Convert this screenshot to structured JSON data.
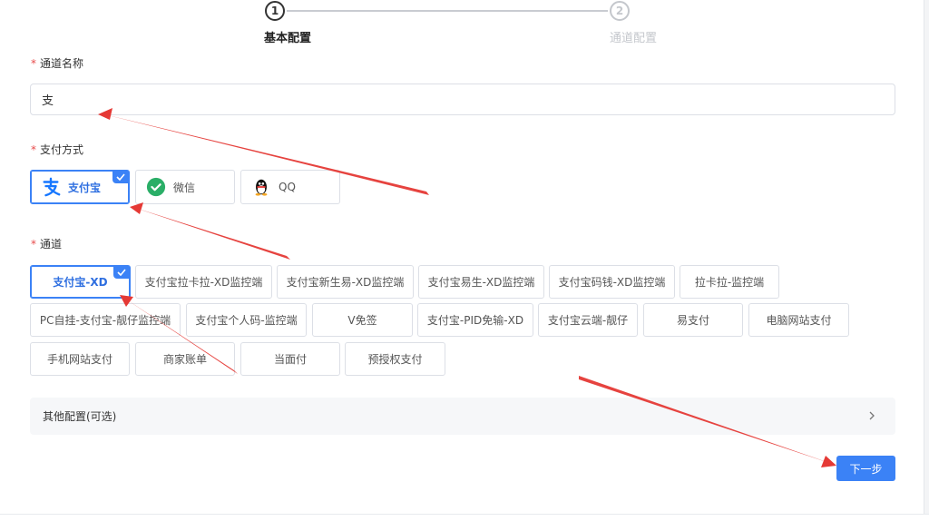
{
  "steps": [
    {
      "number": "1",
      "label": "基本配置",
      "state": "active"
    },
    {
      "number": "2",
      "label": "通道配置",
      "state": "inactive"
    }
  ],
  "form": {
    "channel_name": {
      "label": "通道名称",
      "value": "支"
    },
    "pay_method": {
      "label": "支付方式",
      "options": [
        {
          "label": "支付宝",
          "icon": "alipay-icon",
          "selected": true
        },
        {
          "label": "微信",
          "icon": "wechat-icon",
          "selected": false
        },
        {
          "label": "QQ",
          "icon": "qq-icon",
          "selected": false
        }
      ]
    },
    "channel": {
      "label": "通道",
      "options": [
        {
          "label": "支付宝-XD",
          "selected": true
        },
        {
          "label": "支付宝拉卡拉-XD监控端"
        },
        {
          "label": "支付宝新生易-XD监控端"
        },
        {
          "label": "支付宝易生-XD监控端"
        },
        {
          "label": "支付宝码钱-XD监控端"
        },
        {
          "label": "拉卡拉-监控端"
        },
        {
          "label": "PC自挂-支付宝-靓仔监控端"
        },
        {
          "label": "支付宝个人码-监控端"
        },
        {
          "label": "V免签"
        },
        {
          "label": "支付宝-PID免输-XD"
        },
        {
          "label": "支付宝云端-靓仔"
        },
        {
          "label": "易支付"
        },
        {
          "label": "电脑网站支付"
        },
        {
          "label": "手机网站支付"
        },
        {
          "label": "商家账单"
        },
        {
          "label": "当面付"
        },
        {
          "label": "预授权支付"
        }
      ]
    },
    "other_config": {
      "label": "其他配置(可选)"
    },
    "next_button": "下一步"
  },
  "colors": {
    "accent": "#3b82f6",
    "required": "#e84b4b",
    "annotation_arrow": "#e53935",
    "wechat": "#2aae67",
    "alipay": "#1677ff"
  }
}
